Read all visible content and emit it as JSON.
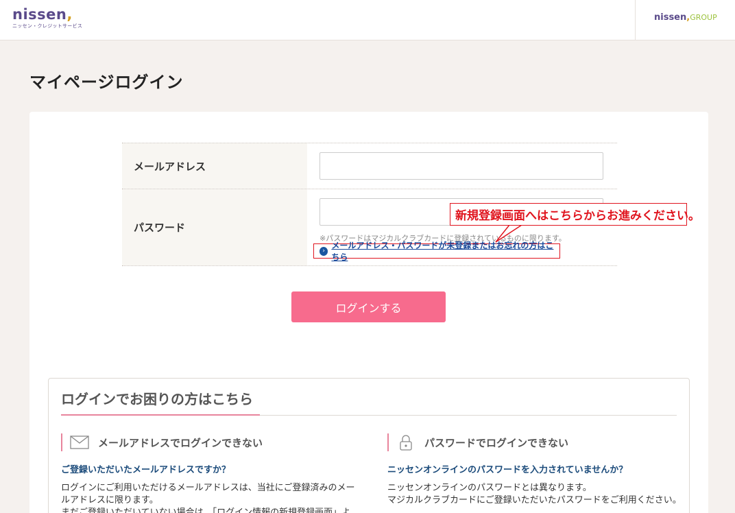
{
  "header": {
    "logo_main": "nissen",
    "logo_sub": "ニッセン・クレジットサービス",
    "group_logo_main": "nissen",
    "group_logo_suffix": "GROUP"
  },
  "page_title": "マイページログイン",
  "form": {
    "email_label": "メールアドレス",
    "email_value": "",
    "password_label": "パスワード",
    "password_value": "",
    "password_note": "※パスワードはマジカルクラブカードに登録されているものに限ります。",
    "register_link": "メールアドレス・パスワードが未登録またはお忘れの方はこちら",
    "login_button": "ログインする"
  },
  "annotation": {
    "callout": "新規登録画面へはこちらからお進みください。",
    "color": "#e0141e"
  },
  "help": {
    "title": "ログインでお困りの方はこちら",
    "left": {
      "heading": "メールアドレスでログインできない",
      "subheading": "ご登録いただいたメールアドレスですか？",
      "body1": "ログインにご利用いただけるメールアドレスは、当社にご登録済みのメールアドレスに限ります。",
      "body2": "まだご登録いただいていない場合は、「ログイン情報の新規登録画面」よ"
    },
    "right": {
      "heading": "パスワードでログインできない",
      "subheading": "ニッセンオンラインのパスワードを入力されていませんか？",
      "body1": "ニッセンオンラインのパスワードとは異なります。",
      "body2": "マジカルクラブカードにご登録いただいたパスワードをご利用ください。"
    }
  },
  "colors": {
    "accent_pink": "#f76b8d",
    "link_blue": "#1a4a9a",
    "brand_purple": "#5a4a8a"
  }
}
